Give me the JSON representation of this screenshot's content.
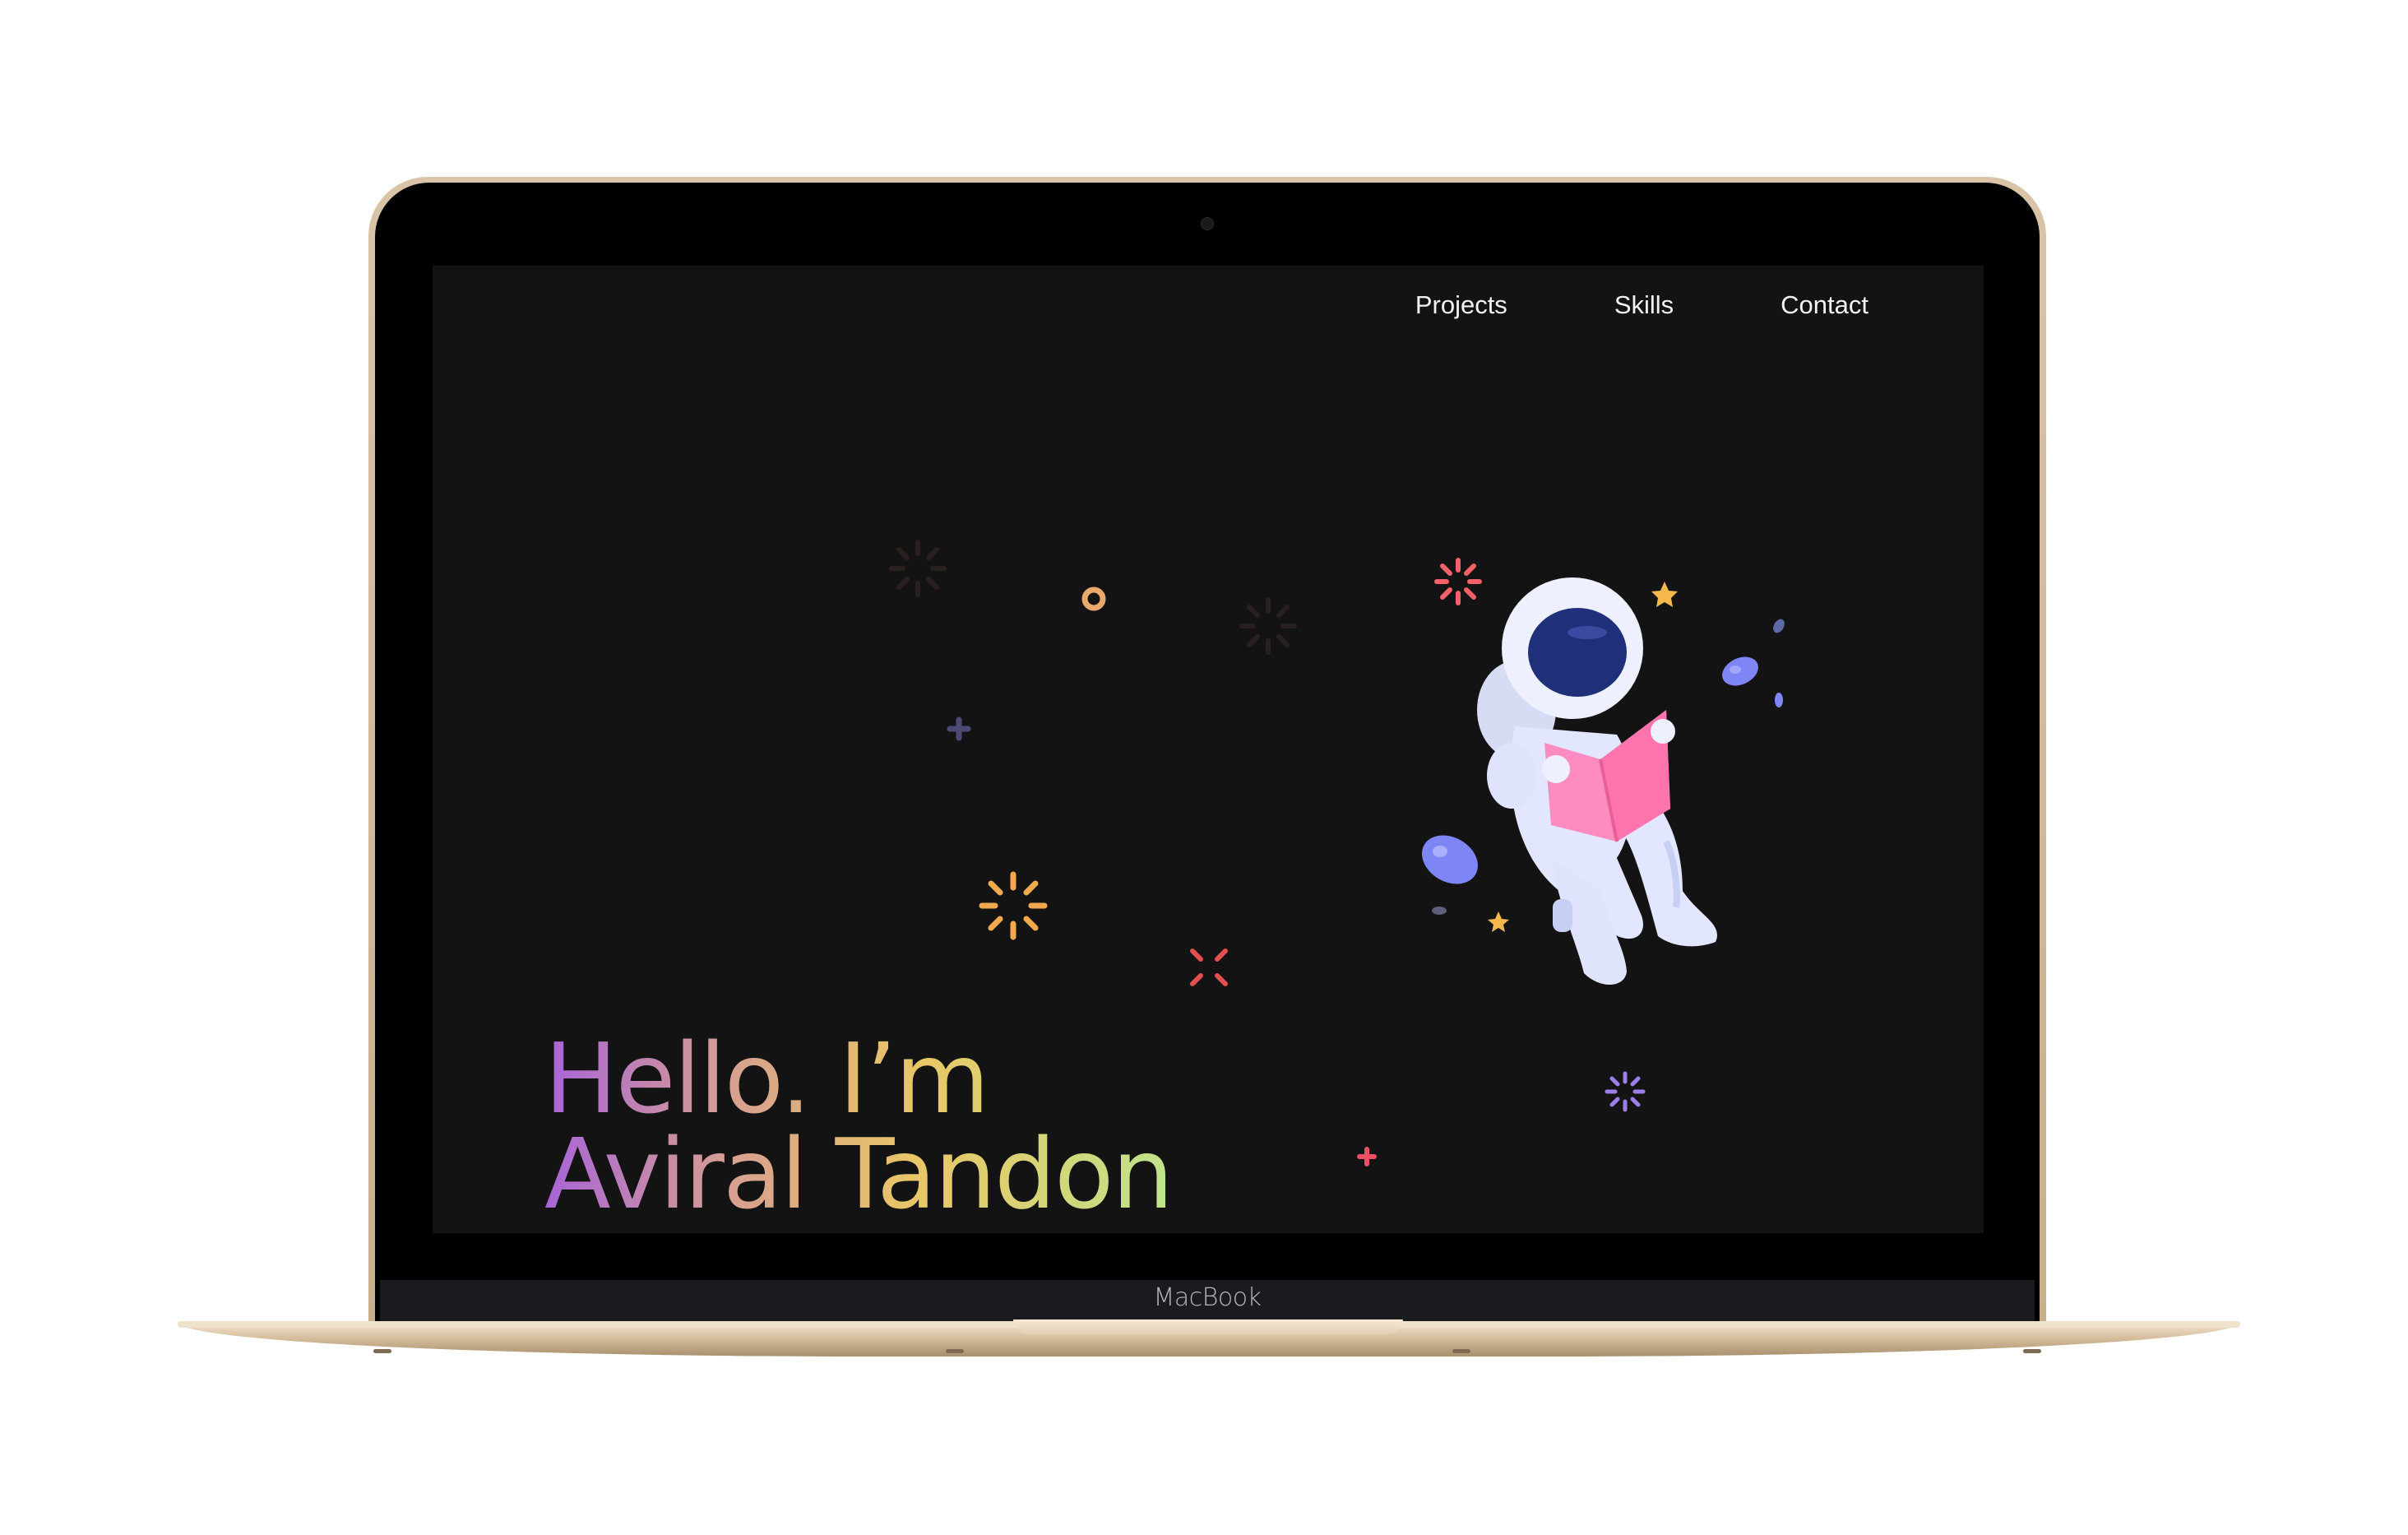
{
  "device": {
    "brand_label": "MacBook"
  },
  "site": {
    "nav": [
      {
        "label": "Projects",
        "icon": null
      },
      {
        "label": "Skills",
        "icon": null
      },
      {
        "label": "Contact",
        "icon": null
      }
    ],
    "hero": {
      "line1": "Hello. I’m",
      "line2": "Aviral Tandon"
    },
    "illustration": {
      "icon": "astronaut-reading-book-icon"
    }
  },
  "colors": {
    "screen_background": "#131313",
    "nav_text": "#f2f2f2",
    "gradient_start": "#a864d8",
    "gradient_mid": "#e9c767",
    "gradient_end": "#bfe38a",
    "book_pink": "#ff7fb2",
    "helmet_navy": "#223280",
    "suit": "#e4e8ff"
  }
}
